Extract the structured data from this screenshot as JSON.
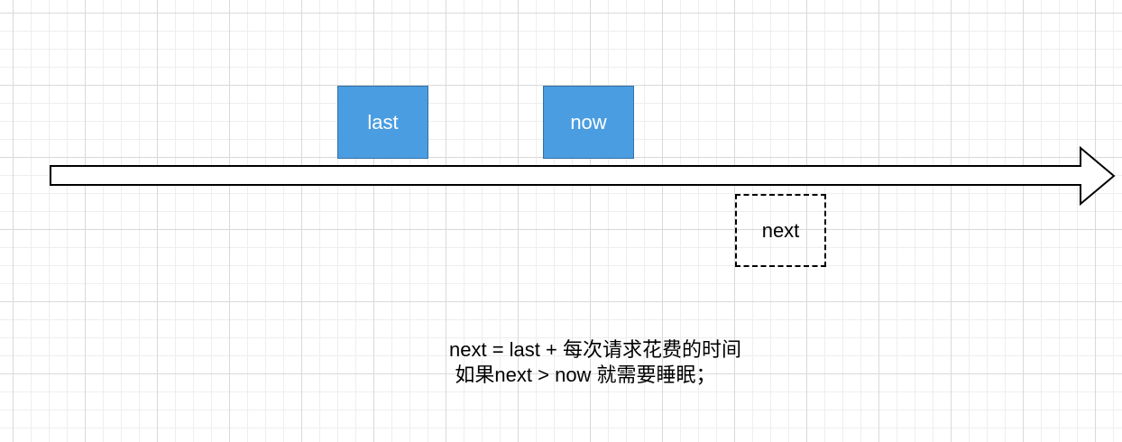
{
  "diagram": {
    "boxes": {
      "last": "last",
      "now": "now",
      "next": "next"
    },
    "caption": {
      "line1": "next = last + 每次请求花费的时间",
      "line2": "如果next > now 就需要睡眠；"
    },
    "colors": {
      "box_fill": "#4a9de0",
      "box_border": "#3571a5",
      "box_text": "#ffffff",
      "arrow_stroke": "#000000",
      "arrow_fill": "#ffffff",
      "dashed_border": "#000000"
    }
  }
}
